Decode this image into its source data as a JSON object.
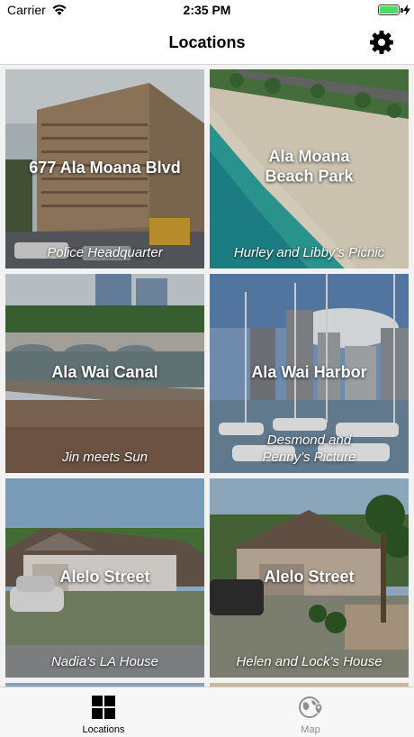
{
  "status_bar": {
    "carrier": "Carrier",
    "time": "2:35 PM",
    "battery_level": 1.0,
    "battery_color": "#4cd964"
  },
  "nav_bar": {
    "title": "Locations",
    "settings_icon": "gear-icon"
  },
  "locations": [
    {
      "name": "677 Ala Moana Blvd",
      "subtitle": "Police Headquarter"
    },
    {
      "name": "Ala Moana\nBeach Park",
      "subtitle": "Hurley and Libby’s Picnic"
    },
    {
      "name": "Ala Wai Canal",
      "subtitle": "Jin meets Sun"
    },
    {
      "name": "Ala Wai Harbor",
      "subtitle": "Desmond and\nPenny’s Picture"
    },
    {
      "name": "Alelo Street",
      "subtitle": "Nadia's LA House"
    },
    {
      "name": "Alelo Street",
      "subtitle": "Helen and Lock's House"
    }
  ],
  "tab_bar": {
    "tabs": [
      {
        "label": "Locations",
        "icon": "grid-icon",
        "selected": true
      },
      {
        "label": "Map",
        "icon": "globe-pin-icon",
        "selected": false
      }
    ]
  }
}
